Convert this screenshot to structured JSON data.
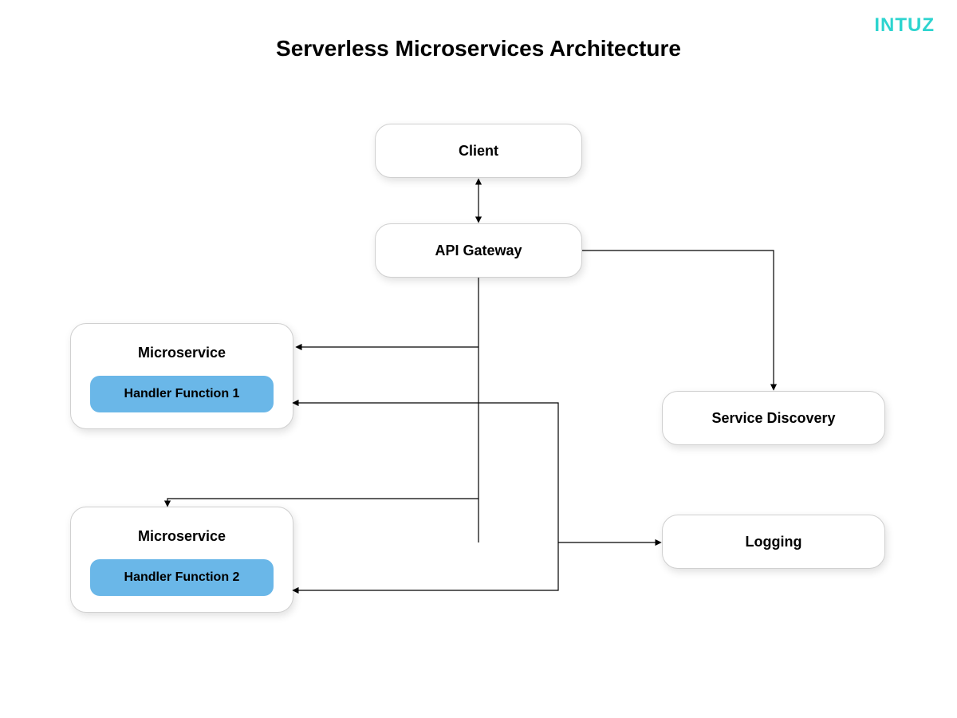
{
  "logo": "INTUZ",
  "title": "Serverless Microservices Architecture",
  "nodes": {
    "client": "Client",
    "api_gateway": "API Gateway",
    "service_discovery": "Service Discovery",
    "logging": "Logging"
  },
  "microservices": [
    {
      "title": "Microservice",
      "handler": "Handler Function 1"
    },
    {
      "title": "Microservice",
      "handler": "Handler Function 2"
    }
  ],
  "colors": {
    "handler_bg": "#6ab7e8",
    "logo_color": "#2dd4cf",
    "shadow": "rgba(0,0,0,0.12)"
  },
  "connections": [
    {
      "from": "client",
      "to": "api_gateway",
      "type": "bidirectional"
    },
    {
      "from": "api_gateway",
      "to": "microservice_1",
      "type": "arrow"
    },
    {
      "from": "api_gateway",
      "to": "microservice_2",
      "type": "arrow"
    },
    {
      "from": "api_gateway",
      "to": "service_discovery",
      "type": "arrow"
    },
    {
      "from": "microservice_1_handler",
      "to": "logging_area",
      "type": "arrow_right"
    },
    {
      "from": "microservice_2_handler",
      "to": "logging_area",
      "type": "arrow_left_in"
    }
  ]
}
